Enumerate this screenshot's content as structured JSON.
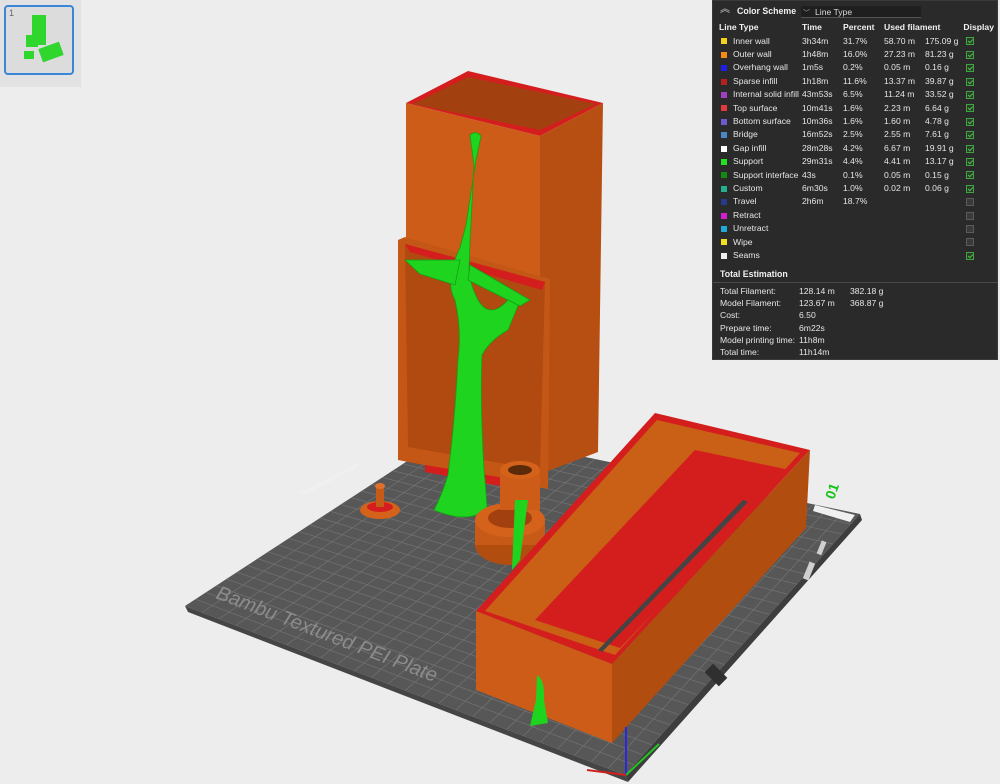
{
  "thumbnail": {
    "index": "1"
  },
  "color_scheme": {
    "title": "Color Scheme",
    "selected": "Line Type",
    "columns": [
      "Line Type",
      "Time",
      "Percent",
      "Used filament",
      "Display"
    ],
    "rows": [
      {
        "name": "Inner wall",
        "time": "3h34m",
        "percent": "31.7%",
        "length": "58.70 m",
        "weight": "175.09 g",
        "color": "#f2d21b",
        "display": true
      },
      {
        "name": "Outer wall",
        "time": "1h48m",
        "percent": "16.0%",
        "length": "27.23 m",
        "weight": "81.23 g",
        "color": "#f28a13",
        "display": true
      },
      {
        "name": "Overhang wall",
        "time": "1m5s",
        "percent": "0.2%",
        "length": "0.05 m",
        "weight": "0.16 g",
        "color": "#1e1ee6",
        "display": true
      },
      {
        "name": "Sparse infill",
        "time": "1h18m",
        "percent": "11.6%",
        "length": "13.37 m",
        "weight": "39.87 g",
        "color": "#b52020",
        "display": true
      },
      {
        "name": "Internal solid infill",
        "time": "43m53s",
        "percent": "6.5%",
        "length": "11.24 m",
        "weight": "33.52 g",
        "color": "#a040c0",
        "display": true
      },
      {
        "name": "Top surface",
        "time": "10m41s",
        "percent": "1.6%",
        "length": "2.23 m",
        "weight": "6.64 g",
        "color": "#e23a3a",
        "display": true
      },
      {
        "name": "Bottom surface",
        "time": "10m36s",
        "percent": "1.6%",
        "length": "1.60 m",
        "weight": "4.78 g",
        "color": "#6a5acd",
        "display": true
      },
      {
        "name": "Bridge",
        "time": "16m52s",
        "percent": "2.5%",
        "length": "2.55 m",
        "weight": "7.61 g",
        "color": "#4a86c8",
        "display": true
      },
      {
        "name": "Gap infill",
        "time": "28m28s",
        "percent": "4.2%",
        "length": "6.67 m",
        "weight": "19.91 g",
        "color": "#ffffff",
        "display": true
      },
      {
        "name": "Support",
        "time": "29m31s",
        "percent": "4.4%",
        "length": "4.41 m",
        "weight": "13.17 g",
        "color": "#22e022",
        "display": true
      },
      {
        "name": "Support interface",
        "time": "43s",
        "percent": "0.1%",
        "length": "0.05 m",
        "weight": "0.15 g",
        "color": "#138a13",
        "display": true
      },
      {
        "name": "Custom",
        "time": "6m30s",
        "percent": "1.0%",
        "length": "0.02 m",
        "weight": "0.06 g",
        "color": "#22b090",
        "display": true
      },
      {
        "name": "Travel",
        "time": "2h6m",
        "percent": "18.7%",
        "length": "",
        "weight": "",
        "color": "#2a3a8a",
        "display": false
      },
      {
        "name": "Retract",
        "time": "",
        "percent": "",
        "length": "",
        "weight": "",
        "color": "#d020d0",
        "display": false
      },
      {
        "name": "Unretract",
        "time": "",
        "percent": "",
        "length": "",
        "weight": "",
        "color": "#20a8d8",
        "display": false
      },
      {
        "name": "Wipe",
        "time": "",
        "percent": "",
        "length": "",
        "weight": "",
        "color": "#f0e020",
        "display": false
      },
      {
        "name": "Seams",
        "time": "",
        "percent": "",
        "length": "",
        "weight": "",
        "color": "#ededed",
        "display": true
      }
    ]
  },
  "total_estimation": {
    "title": "Total Estimation",
    "rows": [
      {
        "label": "Total Filament:",
        "value1": "128.14 m",
        "value2": "382.18 g"
      },
      {
        "label": "Model Filament:",
        "value1": "123.67 m",
        "value2": "368.87 g"
      },
      {
        "label": "Cost:",
        "value1": "6.50",
        "value2": ""
      },
      {
        "label": "Prepare time:",
        "value1": "6m22s",
        "value2": ""
      },
      {
        "label": "Model printing time:",
        "value1": "11h8m",
        "value2": ""
      },
      {
        "label": "Total time:",
        "value1": "11h14m",
        "value2": ""
      }
    ]
  },
  "plate": {
    "label": "Bambu Textured PEI Plate",
    "number": "01",
    "bed_color": "#555555",
    "grid_color": "#727272",
    "wall_color": "#d4621a",
    "wall_dark": "#b24d10",
    "top_color": "#d41e1e",
    "support_color": "#1ed21e"
  }
}
